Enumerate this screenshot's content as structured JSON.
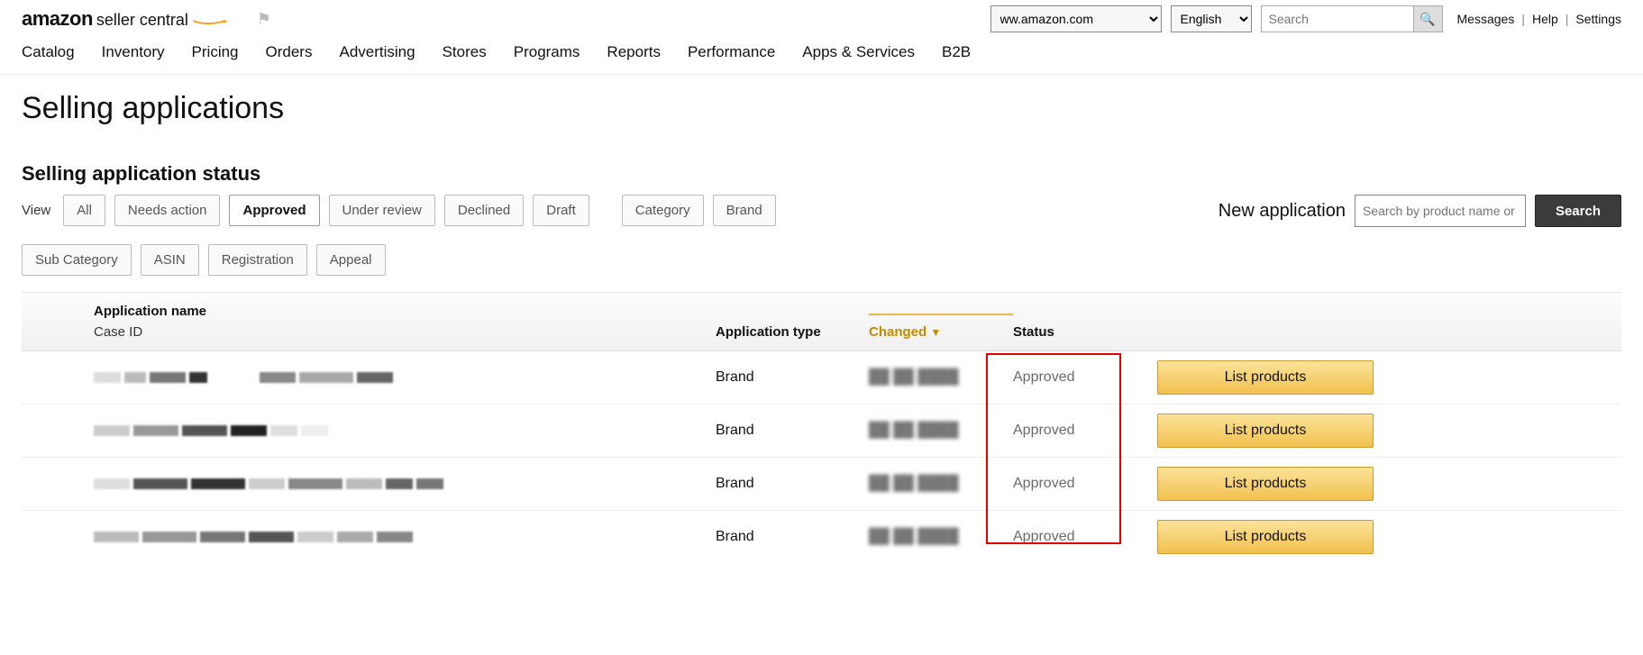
{
  "header": {
    "brand_main": "amazon",
    "brand_sub": "seller central",
    "marketplace_selected": "ww.amazon.com",
    "language_selected": "English",
    "search_placeholder": "Search",
    "links": {
      "messages": "Messages",
      "help": "Help",
      "settings": "Settings"
    }
  },
  "nav": [
    "Catalog",
    "Inventory",
    "Pricing",
    "Orders",
    "Advertising",
    "Stores",
    "Programs",
    "Reports",
    "Performance",
    "Apps & Services",
    "B2B"
  ],
  "page": {
    "title": "Selling applications",
    "subtitle": "Selling application status",
    "view_label": "View",
    "filters_row1": [
      {
        "label": "All",
        "active": false
      },
      {
        "label": "Needs action",
        "active": false
      },
      {
        "label": "Approved",
        "active": true
      },
      {
        "label": "Under review",
        "active": false
      },
      {
        "label": "Declined",
        "active": false
      },
      {
        "label": "Draft",
        "active": false
      }
    ],
    "filters_row1b": [
      {
        "label": "Category",
        "active": false
      },
      {
        "label": "Brand",
        "active": false
      }
    ],
    "filters_row2": [
      {
        "label": "Sub Category",
        "active": false
      },
      {
        "label": "ASIN",
        "active": false
      },
      {
        "label": "Registration",
        "active": false
      },
      {
        "label": "Appeal",
        "active": false
      }
    ],
    "newapp": {
      "label": "New application",
      "placeholder": "Search by product name or ASIN",
      "button": "Search"
    }
  },
  "table": {
    "headers": {
      "name_l1": "Application name",
      "name_l2": "Case ID",
      "type": "Application type",
      "changed": "Changed",
      "status": "Status"
    },
    "rows": [
      {
        "type": "Brand",
        "changed": "██ ██ ████",
        "status": "Approved",
        "action": "List products"
      },
      {
        "type": "Brand",
        "changed": "██ ██ ████",
        "status": "Approved",
        "action": "List products"
      },
      {
        "type": "Brand",
        "changed": "██ ██ ████",
        "status": "Approved",
        "action": "List products"
      },
      {
        "type": "Brand",
        "changed": "██ ██ ████",
        "status": "Approved",
        "action": "List products"
      }
    ]
  }
}
